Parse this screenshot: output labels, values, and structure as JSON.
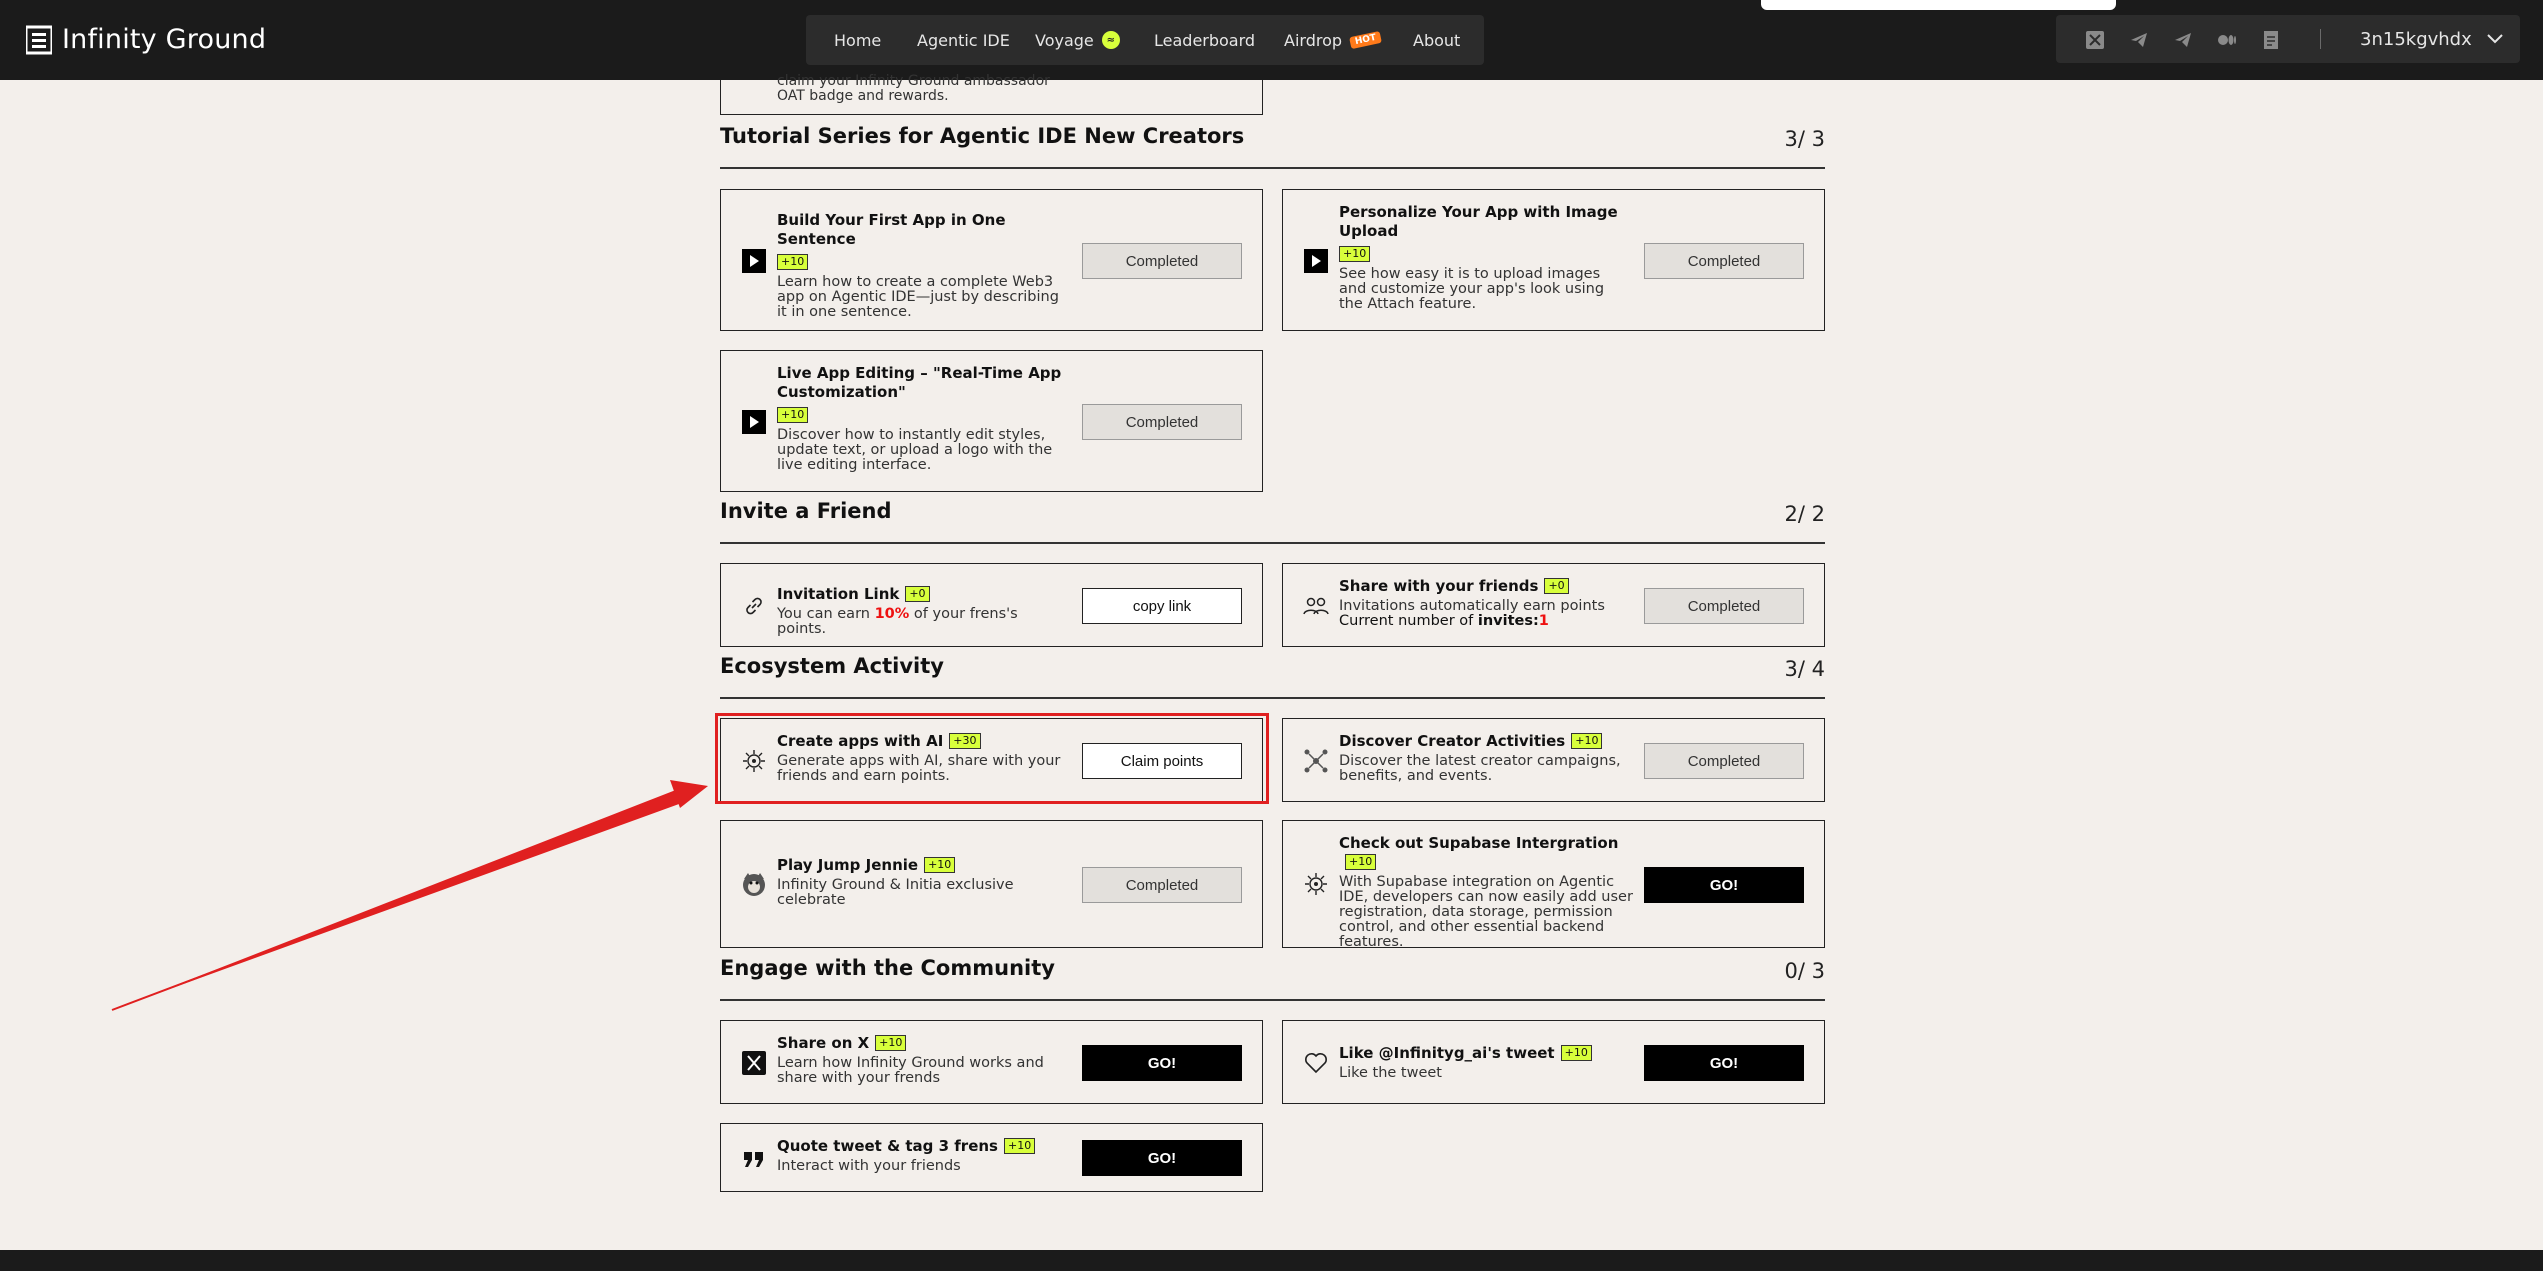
{
  "header": {
    "logo": "Infinity Ground",
    "nav": [
      {
        "label": "Home"
      },
      {
        "label": "Agentic IDE"
      },
      {
        "label": "Voyage"
      },
      {
        "label": "Leaderboard"
      },
      {
        "label": "Airdrop",
        "badge": "HOT"
      },
      {
        "label": "About"
      }
    ],
    "socials": [
      "x-icon",
      "telegram-icon",
      "telegram-icon",
      "medium-icon",
      "docs-icon"
    ],
    "wallet": "3n15kgvhdx"
  },
  "top_stub": "claim your Infinity Ground ambassador\nOAT badge and rewards.",
  "sections": {
    "tutorial": {
      "title": "Tutorial Series for Agentic IDE New Creators",
      "count": "3/ 3",
      "cards": [
        {
          "title": "Build Your First App in One Sentence",
          "points": "+10",
          "desc": "Learn how to create a complete Web3 app on Agentic IDE—just by describing it in one sentence.",
          "button": "Completed"
        },
        {
          "title": "Personalize Your App with Image Upload",
          "points": "+10",
          "desc": "See how easy it is to upload images and customize your app's look using the Attach feature.",
          "button": "Completed"
        },
        {
          "title": "Live App Editing – \"Real-Time App Customization\"",
          "points": "+10",
          "desc": "Discover how to instantly edit styles, update text, or upload a logo with the live editing interface.",
          "button": "Completed"
        }
      ]
    },
    "invite": {
      "title": "Invite a Friend",
      "count": "2/ 2",
      "cards": [
        {
          "title": "Invitation Link",
          "points": "+0",
          "desc_pre": "You can earn ",
          "desc_red": "10%",
          "desc_post": " of your frens's points.",
          "button": "copy link"
        },
        {
          "title": "Share with your friends",
          "points": "+0",
          "desc": "Invitations automatically earn points",
          "desc2_pre": "Current number of ",
          "desc2_bold": "invites:",
          "desc2_red": "1",
          "button": "Completed"
        }
      ]
    },
    "ecosystem": {
      "title": "Ecosystem Activity",
      "count": "3/ 4",
      "cards": [
        {
          "title": "Create apps with AI",
          "points": "+30",
          "desc": "Generate apps with AI, share with your friends and earn points.",
          "button": "Claim points"
        },
        {
          "title": "Discover Creator Activities",
          "points": "+10",
          "desc": "Discover the latest creator campaigns, benefits, and events.",
          "button": "Completed"
        },
        {
          "title": "Play Jump Jennie",
          "points": "+10",
          "desc": "Infinity Ground & Initia exclusive celebrate",
          "button": "Completed"
        },
        {
          "title": "Check out Supabase Intergration",
          "points": "+10",
          "desc": "With Supabase integration on Agentic IDE, developers can now easily add user registration, data storage, permission control, and other essential backend features.",
          "button": "GO!"
        }
      ]
    },
    "community": {
      "title": "Engage with the Community",
      "count": "0/ 3",
      "cards": [
        {
          "title": "Share on X",
          "points": "+10",
          "desc": "Learn how Infinity Ground works and share with your frends",
          "button": "GO!"
        },
        {
          "title": "Like @Infinityg_ai's tweet",
          "points": "+10",
          "desc": "Like the tweet",
          "button": "GO!"
        },
        {
          "title": "Quote tweet & tag 3 frens",
          "points": "+10",
          "desc": "Interact with your friends",
          "button": "GO!"
        }
      ]
    }
  },
  "colors": {
    "accent": "#d8ff3b",
    "highlight": "#e02020",
    "header": "#1b1b1b",
    "background": "#f3efeb"
  }
}
